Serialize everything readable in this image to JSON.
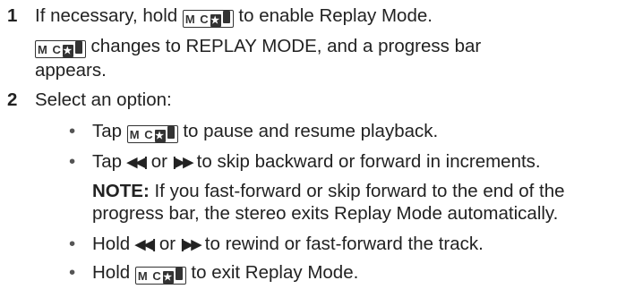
{
  "steps": [
    {
      "number": "1",
      "line1_before": "If necessary, hold",
      "line1_after": "to enable Replay Mode.",
      "line2_after": "changes to REPLAY MODE, and a progress bar",
      "line3": "appears."
    },
    {
      "number": "2",
      "text": "Select an option:"
    }
  ],
  "button_glyph": {
    "icon": "replay-mode-button-icon",
    "segments": [
      "M",
      "C",
      "★",
      "▌"
    ]
  },
  "options": [
    {
      "bullet": "•",
      "before": "Tap",
      "after": "to pause and resume playback."
    },
    {
      "bullet": "•",
      "before": "Tap",
      "middle": "or",
      "after": "to skip backward or forward in increments.",
      "prev_icon": "⏮",
      "next_icon": "⏭"
    },
    {
      "bullet": "•",
      "before": "Hold",
      "middle": "or",
      "after": "to rewind or fast-forward the track.",
      "prev_icon": "⏮",
      "next_icon": "⏭"
    },
    {
      "bullet": "•",
      "before": "Hold",
      "after": "to exit Replay Mode."
    }
  ],
  "note": {
    "label": "NOTE:",
    "line1": "If you fast-forward or skip forward to the end of the",
    "line2": "progress bar, the stereo exits Replay Mode automatically."
  }
}
